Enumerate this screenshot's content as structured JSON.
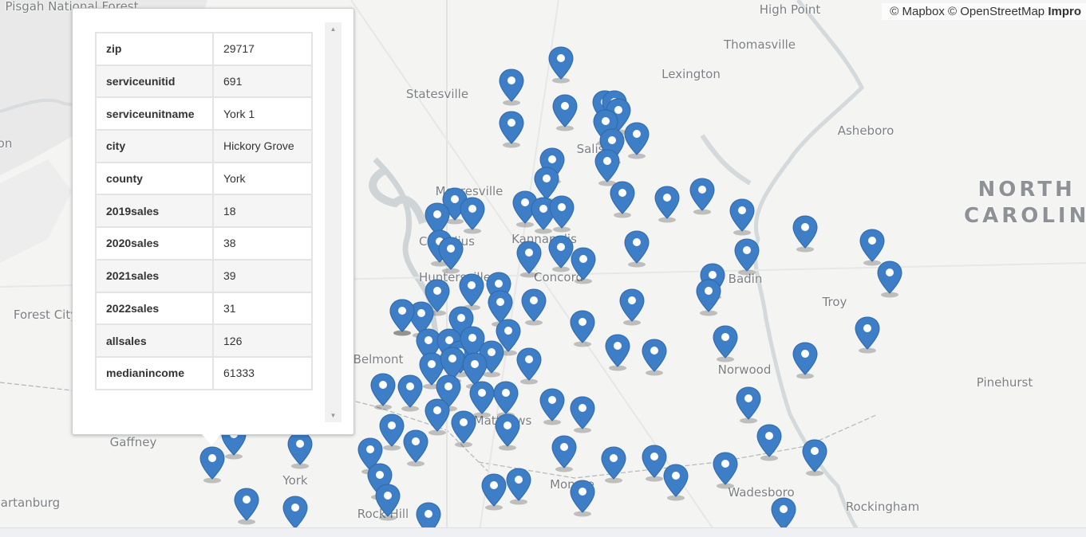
{
  "map": {
    "attribution": {
      "mapbox": "© Mapbox",
      "osm": "© OpenStreetMap",
      "improve": "Impro"
    },
    "state_label": "NORTH\nCAROLIN",
    "places": [
      {
        "name": "Pisgah National Forest",
        "key": "pisgah"
      },
      {
        "name": "High Point",
        "key": "highpoint"
      },
      {
        "name": "Thomasville",
        "key": "thomasville"
      },
      {
        "name": "Lexington",
        "key": "lexington"
      },
      {
        "name": "Statesville",
        "key": "statesville"
      },
      {
        "name": "Asheboro",
        "key": "asheboro"
      },
      {
        "name": "Salis",
        "key": "salisbury"
      },
      {
        "name": "Mooresville",
        "key": "mooresville"
      },
      {
        "name": "Cornelius",
        "key": "cornelius"
      },
      {
        "name": "Kannapolis",
        "key": "kannapolis"
      },
      {
        "name": "Huntersville",
        "key": "huntersville"
      },
      {
        "name": "Concord",
        "key": "concord"
      },
      {
        "name": "Badin",
        "key": "badin"
      },
      {
        "name": "Troy",
        "key": "troy"
      },
      {
        "name": "Forest City",
        "key": "forestcity"
      },
      {
        "name": "Belmont",
        "key": "belmont"
      },
      {
        "name": "Norwood",
        "key": "norwood"
      },
      {
        "name": "Pinehurst",
        "key": "pinehurst"
      },
      {
        "name": "Matthews",
        "key": "matthews"
      },
      {
        "name": "Gaffney",
        "key": "gaffney"
      },
      {
        "name": "York",
        "key": "york"
      },
      {
        "name": "Monroe",
        "key": "monroe"
      },
      {
        "name": "Wadesboro",
        "key": "wadesboro"
      },
      {
        "name": "artanburg",
        "key": "spartanburg"
      },
      {
        "name": "Rockingham",
        "key": "rockingham"
      },
      {
        "name": "Rock Hill",
        "key": "rockhill"
      },
      {
        "name": "on",
        "key": "edge_on"
      }
    ],
    "marker_color": "#3d7ec7"
  },
  "popup": {
    "rows": [
      {
        "key": "zip",
        "value": "29717"
      },
      {
        "key": "serviceunitid",
        "value": "691"
      },
      {
        "key": "serviceunitname",
        "value": "York 1"
      },
      {
        "key": "city",
        "value": "Hickory Grove"
      },
      {
        "key": "county",
        "value": "York"
      },
      {
        "key": "2019sales",
        "value": "18"
      },
      {
        "key": "2020sales",
        "value": "38"
      },
      {
        "key": "2021sales",
        "value": "39"
      },
      {
        "key": "2022sales",
        "value": "31"
      },
      {
        "key": "allsales",
        "value": "126"
      },
      {
        "key": "medianincome",
        "value": "61333"
      }
    ]
  }
}
